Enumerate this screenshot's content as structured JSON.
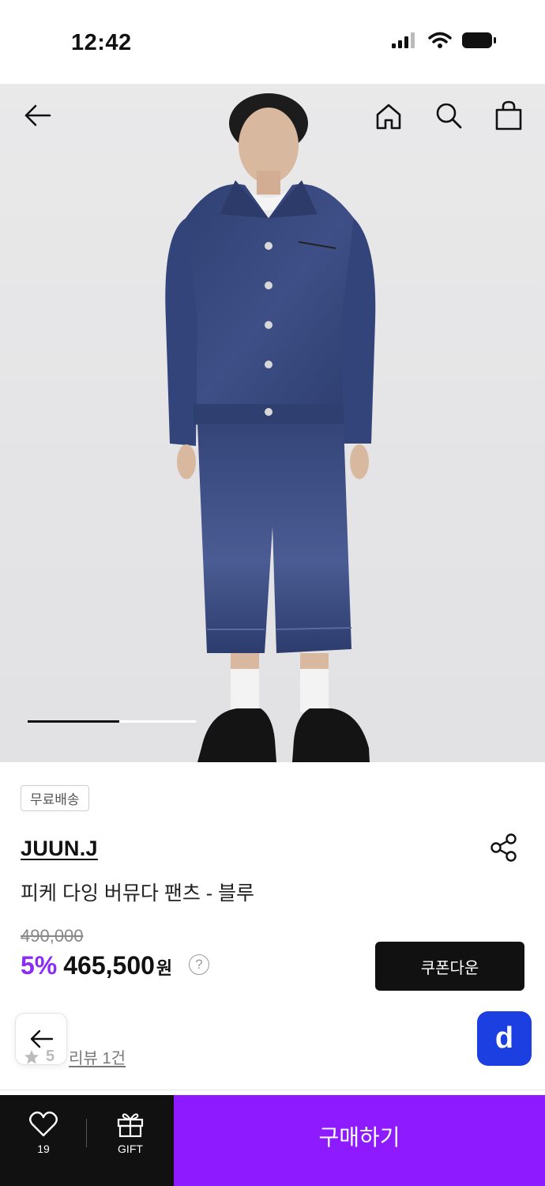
{
  "status": {
    "time": "12:42"
  },
  "hero": {
    "image_index": 1,
    "image_count": 2
  },
  "product": {
    "badge": "무료배송",
    "brand": "JUUN.J",
    "title": "피케 다잉 버뮤다 팬츠 - 블루",
    "original_price": "490,000",
    "discount": "5%",
    "price": "465,500",
    "currency": "원",
    "help": "?"
  },
  "coupon": {
    "label": "쿠폰다운"
  },
  "rating": {
    "value": "5",
    "review_label": "리뷰 1건"
  },
  "floating": {
    "d_label": "d"
  },
  "bottom": {
    "like_count": "19",
    "gift_label": "GIFT",
    "buy_label": "구매하기"
  },
  "colors": {
    "accent": "#8e1bff",
    "discount": "#8b2cf5",
    "d_button": "#1b3fe0",
    "dark": "#111111"
  }
}
